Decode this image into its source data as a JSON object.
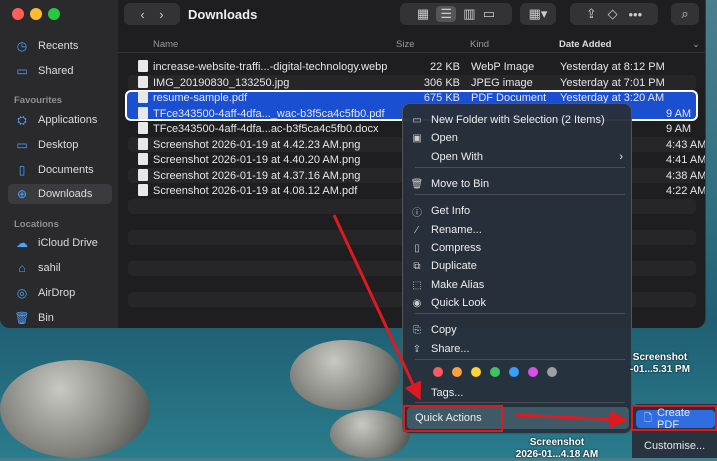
{
  "window": {
    "title": "Downloads"
  },
  "sidebar": {
    "sections": [
      {
        "label": "",
        "items": [
          {
            "label": "Recents",
            "icon": "clock-icon"
          },
          {
            "label": "Shared",
            "icon": "shared-folder-icon"
          }
        ]
      },
      {
        "label": "Favourites",
        "items": [
          {
            "label": "Applications",
            "icon": "applications-icon"
          },
          {
            "label": "Desktop",
            "icon": "desktop-icon"
          },
          {
            "label": "Documents",
            "icon": "document-icon"
          },
          {
            "label": "Downloads",
            "icon": "download-icon",
            "active": true
          }
        ]
      },
      {
        "label": "Locations",
        "items": [
          {
            "label": "iCloud Drive",
            "icon": "cloud-icon"
          },
          {
            "label": "sahil",
            "icon": "home-icon"
          },
          {
            "label": "AirDrop",
            "icon": "airdrop-icon"
          },
          {
            "label": "Bin",
            "icon": "trash-icon"
          }
        ]
      }
    ]
  },
  "columns": {
    "name": "Name",
    "size": "Size",
    "kind": "Kind",
    "date": "Date Added"
  },
  "files": [
    {
      "name": "increase-website-traffi...-digital-technology.webp",
      "size": "22 KB",
      "kind": "WebP Image",
      "date": "Yesterday at 8:12 PM"
    },
    {
      "name": "IMG_20190830_133250.jpg",
      "size": "306 KB",
      "kind": "JPEG image",
      "date": "Yesterday at 7:01 PM"
    },
    {
      "name": "resume-sample.pdf",
      "size": "675 KB",
      "kind": "PDF Document",
      "date": "Yesterday at 3:20 AM",
      "selected": true
    },
    {
      "name": "TFce343500-4aff-4dfa..._wac-b3f5ca4c5fb0.pdf",
      "size": "",
      "kind": "",
      "date": "9 AM",
      "selected": true
    },
    {
      "name": "TFce343500-4aff-4dfa...ac-b3f5ca4c5fb0.docx",
      "size": "",
      "kind": "",
      "date": "9 AM"
    },
    {
      "name": "Screenshot 2026-01-19 at 4.42.23 AM.png",
      "size": "",
      "kind": "",
      "date": "4:43 AM"
    },
    {
      "name": "Screenshot 2026-01-19 at 4.40.20 AM.png",
      "size": "",
      "kind": "",
      "date": "4:41 AM"
    },
    {
      "name": "Screenshot 2026-01-19 at 4.37.16 AM.png",
      "size": "",
      "kind": "",
      "date": "4:38 AM"
    },
    {
      "name": "Screenshot 2026-01-19 at 4.08.12 AM.pdf",
      "size": "",
      "kind": "",
      "date": "4:22 AM"
    }
  ],
  "context_menu": {
    "items": [
      {
        "label": "New Folder with Selection (2 Items)",
        "icon": "new-folder-icon"
      },
      {
        "label": "Open",
        "icon": "open-icon"
      },
      {
        "label": "Open With",
        "icon": "",
        "submenu": true
      },
      {
        "label": "Move to Bin",
        "icon": "trash-icon"
      },
      {
        "label": "Get Info",
        "icon": "info-icon"
      },
      {
        "label": "Rename...",
        "icon": "pencil-icon"
      },
      {
        "label": "Compress",
        "icon": "archive-icon"
      },
      {
        "label": "Duplicate",
        "icon": "duplicate-icon"
      },
      {
        "label": "Make Alias",
        "icon": "alias-icon"
      },
      {
        "label": "Quick Look",
        "icon": "eye-icon"
      },
      {
        "label": "Copy",
        "icon": "copy-icon"
      },
      {
        "label": "Share...",
        "icon": "share-icon"
      },
      {
        "label": "Tags...",
        "icon": "tag-icon"
      },
      {
        "label": "Quick Actions",
        "icon": "",
        "submenu": true,
        "highlighted": true
      }
    ],
    "tag_colors": [
      "#ff5a5f",
      "#ff9f43",
      "#ffd43b",
      "#40c463",
      "#3b9eff",
      "#d94fe8",
      "#a0a0a0"
    ]
  },
  "submenu": {
    "create_pdf": "Create PDF",
    "customise": "Customise..."
  },
  "desktop": {
    "labels": [
      {
        "line1": "Screenshot",
        "line2": "-01...5.31 PM"
      },
      {
        "line1": "Screenshot",
        "line2": "2026-01...4.18 AM"
      }
    ]
  },
  "accent": "#1b4fd1",
  "annotation_color": "#e0191f"
}
